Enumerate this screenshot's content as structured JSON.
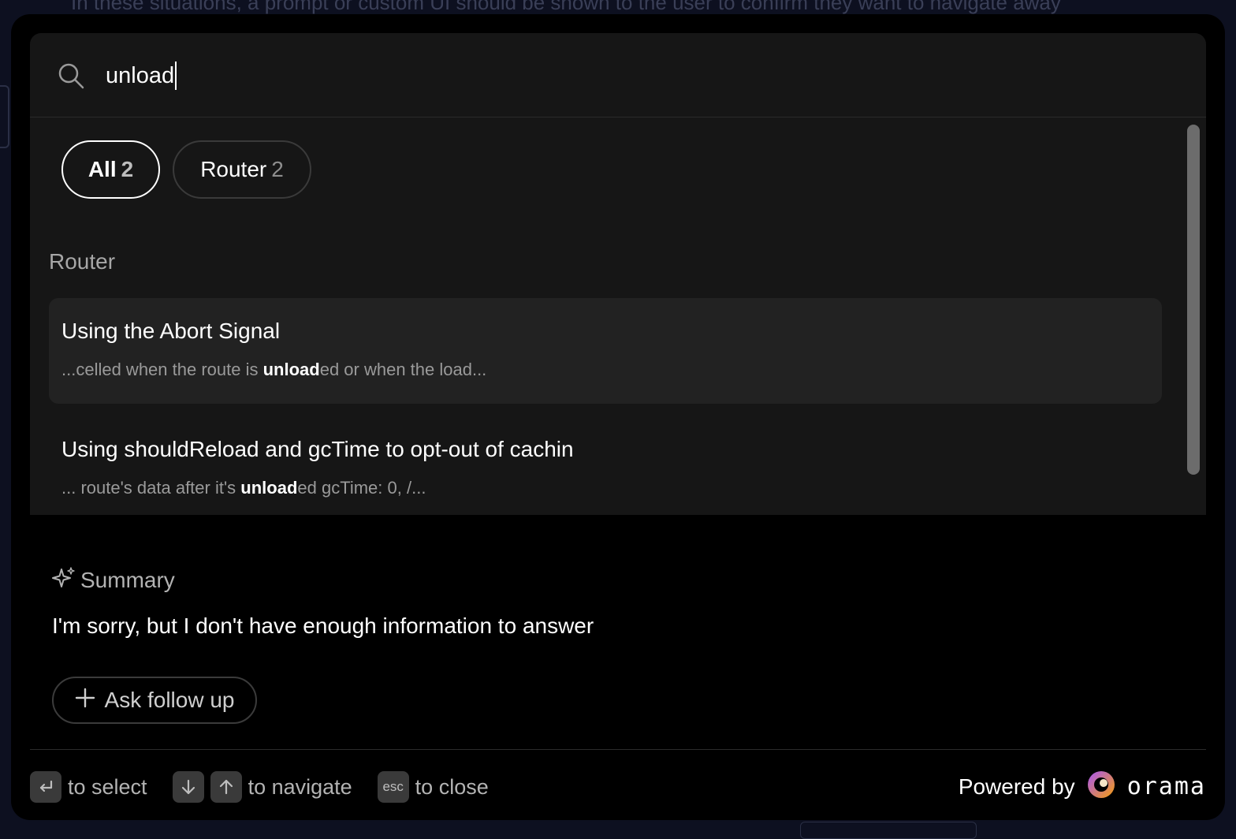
{
  "background": {
    "top_text": "In these situations, a prompt or custom UI should be shown to the user to confirm they want to navigate away"
  },
  "search": {
    "value": "unload",
    "placeholder": ""
  },
  "filters": [
    {
      "label": "All",
      "count": "2",
      "selected": true
    },
    {
      "label": "Router",
      "count": "2",
      "selected": false
    }
  ],
  "group_title": "Router",
  "results": [
    {
      "title": "Using the Abort Signal",
      "snippet_before": "...celled when the route is ",
      "snippet_match": "unload",
      "snippet_after": "ed or when the load..."
    },
    {
      "title": "Using shouldReload and gcTime to opt-out of cachin",
      "snippet_before": "... route's data after it's ",
      "snippet_match": "unload",
      "snippet_after": "ed gcTime: 0, /..."
    }
  ],
  "summary": {
    "label": "Summary",
    "text": "I'm sorry, but I don't have enough information to answer",
    "followup_label": "Ask follow up"
  },
  "footer": {
    "select_hint": "to select",
    "navigate_hint": "to navigate",
    "esc_key": "esc",
    "close_hint": "to close",
    "powered_by": "Powered by",
    "brand": "orama"
  },
  "icons": {
    "search": "search-icon",
    "sparkle": "sparkle-icon",
    "plus": "plus-icon",
    "enter": "enter-icon",
    "arrow_down": "arrow-down-icon",
    "arrow_up": "arrow-up-icon",
    "logo": "orama-logo-icon"
  },
  "colors": {
    "page_bg": "#0d1020",
    "modal_bg": "#000000",
    "panel_bg": "#161616",
    "active_row_bg": "#222222",
    "brand_gradient": [
      "#a855f7",
      "#f59e0b"
    ]
  }
}
